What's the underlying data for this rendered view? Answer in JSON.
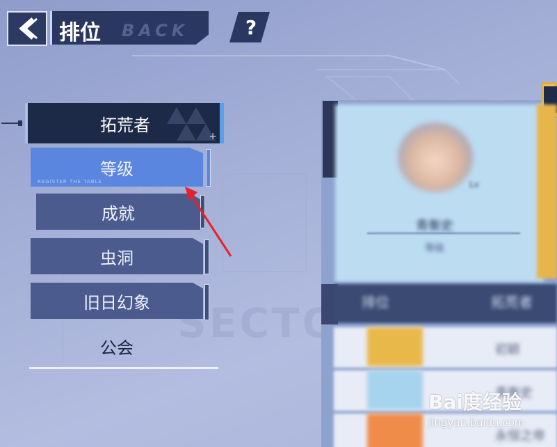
{
  "header": {
    "title": "排位",
    "title_watermark": "BACK",
    "help_label": "?"
  },
  "menu": {
    "items": [
      {
        "label": "拓荒者",
        "state": "active"
      },
      {
        "label": "等级",
        "state": "selected"
      },
      {
        "label": "成就",
        "state": "normal"
      },
      {
        "label": "虫洞",
        "state": "normal"
      },
      {
        "label": "旧日幻象",
        "state": "normal"
      },
      {
        "label": "公会",
        "state": "plain"
      }
    ],
    "level_small_caption": "REGISTER THE TABLE"
  },
  "background_text": "SECTOR",
  "profile": {
    "name": "青衡史",
    "sub": "等级",
    "badge": "Lv"
  },
  "table": {
    "headers": [
      "排位",
      "拓荒者"
    ],
    "rows": [
      {
        "name": "初颖",
        "color": "#e9b84a"
      },
      {
        "name": "青衡史",
        "color": "#a6d3ee"
      },
      {
        "name": "永恒之帝",
        "color": "#f08c4a"
      }
    ]
  },
  "watermark": {
    "logo": "Bai度经验",
    "url": "jingyan.baidu.com"
  },
  "colors": {
    "accent_blue": "#5a86e0",
    "panel_dark": "#2a3760",
    "annotation_red": "#e8202a"
  }
}
